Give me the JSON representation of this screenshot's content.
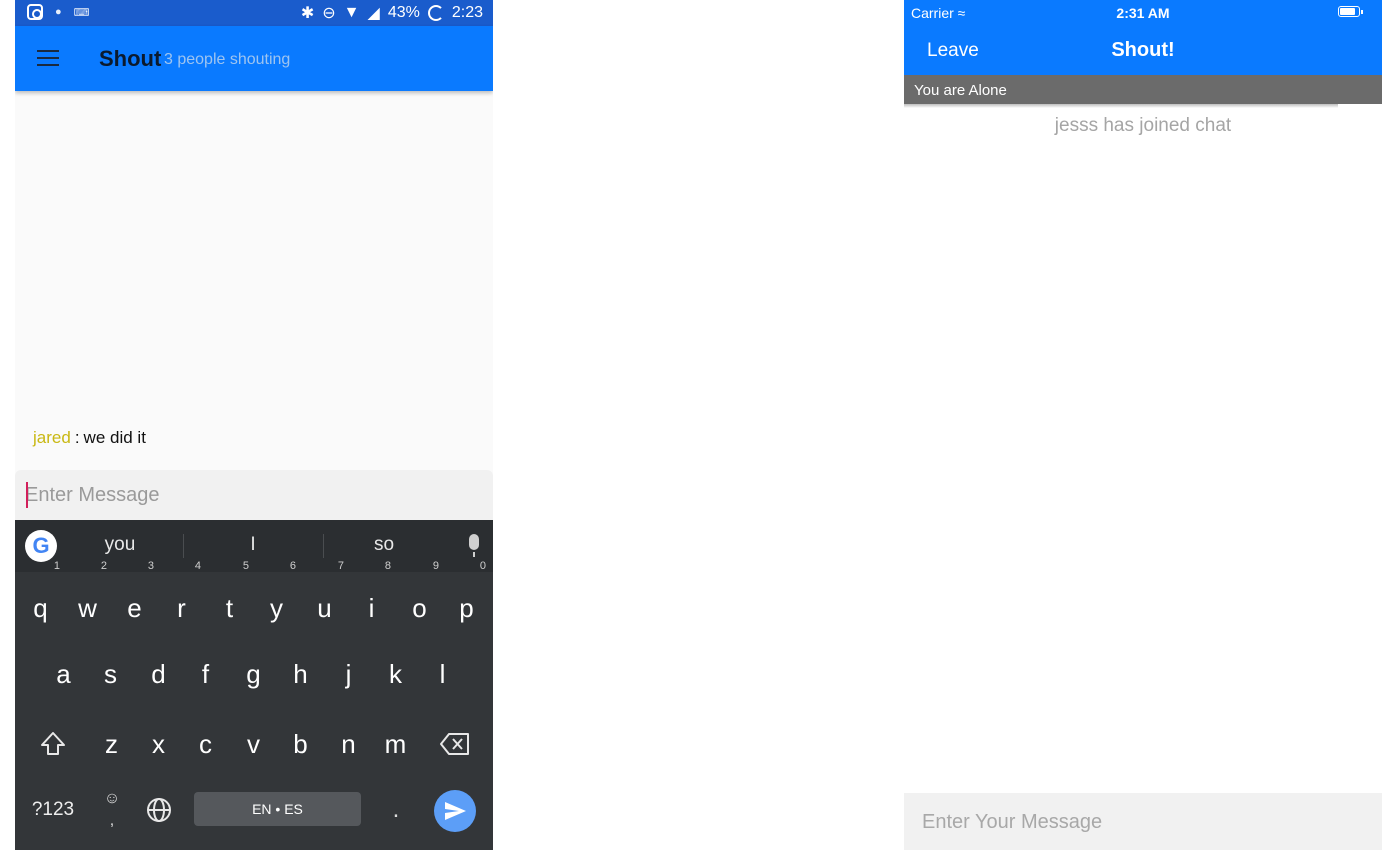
{
  "android": {
    "status_bar": {
      "battery_percent": "43%",
      "time": "2:23",
      "icons": [
        "instagram-icon",
        "notification-icon",
        "keyboard-icon",
        "bluetooth-icon",
        "dnd-icon",
        "wifi-icon",
        "signal-icon",
        "loading-icon"
      ]
    },
    "toolbar": {
      "title": "Shout",
      "subtitle": "3 people shouting",
      "menu_icon": "hamburger-menu-icon"
    },
    "messages": [
      {
        "user": "jared",
        "separator": ":",
        "text": "we did it"
      }
    ],
    "input": {
      "placeholder": "Enter Message",
      "value": ""
    },
    "keyboard": {
      "suggestions": [
        "you",
        "I",
        "so"
      ],
      "row1": [
        {
          "key": "q",
          "hint": "1"
        },
        {
          "key": "w",
          "hint": "2"
        },
        {
          "key": "e",
          "hint": "3"
        },
        {
          "key": "r",
          "hint": "4"
        },
        {
          "key": "t",
          "hint": "5"
        },
        {
          "key": "y",
          "hint": "6"
        },
        {
          "key": "u",
          "hint": "7"
        },
        {
          "key": "i",
          "hint": "8"
        },
        {
          "key": "o",
          "hint": "9"
        },
        {
          "key": "p",
          "hint": "0"
        }
      ],
      "row2": [
        "a",
        "s",
        "d",
        "f",
        "g",
        "h",
        "j",
        "k",
        "l"
      ],
      "row3": [
        "z",
        "x",
        "c",
        "v",
        "b",
        "n",
        "m"
      ],
      "symbols_key": "?123",
      "space_label": "EN • ES",
      "period_key": ".",
      "emoji_comma": ",",
      "google_logo": "G"
    },
    "colors": {
      "primary": "#0a7aff",
      "status_bar": "#1a5ccc",
      "username": "#c9b813",
      "keyboard_bg": "#333639",
      "send_button": "#5c9ef7"
    }
  },
  "ios": {
    "status_bar": {
      "carrier": "Carrier",
      "time": "2:31 AM"
    },
    "nav": {
      "leave_label": "Leave",
      "title": "Shout!"
    },
    "banner": {
      "text": "You are Alone"
    },
    "events": [
      {
        "text": "jesss has joined chat"
      }
    ],
    "input": {
      "placeholder": "Enter Your Message",
      "value": ""
    },
    "colors": {
      "primary": "#0a7aff",
      "banner": "#6b6b6b",
      "event_text": "#a5a5a5"
    }
  }
}
